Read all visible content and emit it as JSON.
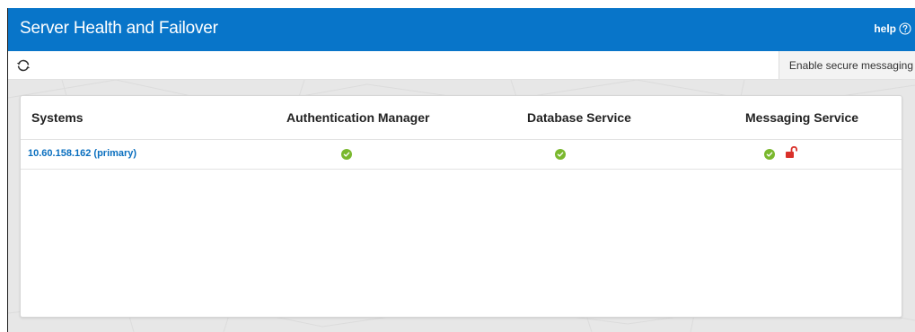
{
  "header": {
    "title": "Server Health and Failover",
    "help_label": "help"
  },
  "toolbar": {
    "refresh_icon": "refresh-icon",
    "secure_messaging_label": "Enable secure messaging"
  },
  "table": {
    "columns": [
      "Systems",
      "Authentication Manager",
      "Database Service",
      "Messaging Service"
    ],
    "rows": [
      {
        "system": "10.60.158.162 (primary)",
        "authentication_manager": "ok",
        "database_service": "ok",
        "messaging_service": "ok",
        "messaging_security": "unlocked"
      }
    ]
  },
  "colors": {
    "header_bg": "#0875c9",
    "link": "#0a6fbf",
    "status_ok": "#7ab82e",
    "unlocked_red": "#d9302a"
  },
  "icons": {
    "status_ok": "check-circle-icon",
    "messaging_security": "unlocked-padlock-icon",
    "help": "question-circle-icon"
  }
}
